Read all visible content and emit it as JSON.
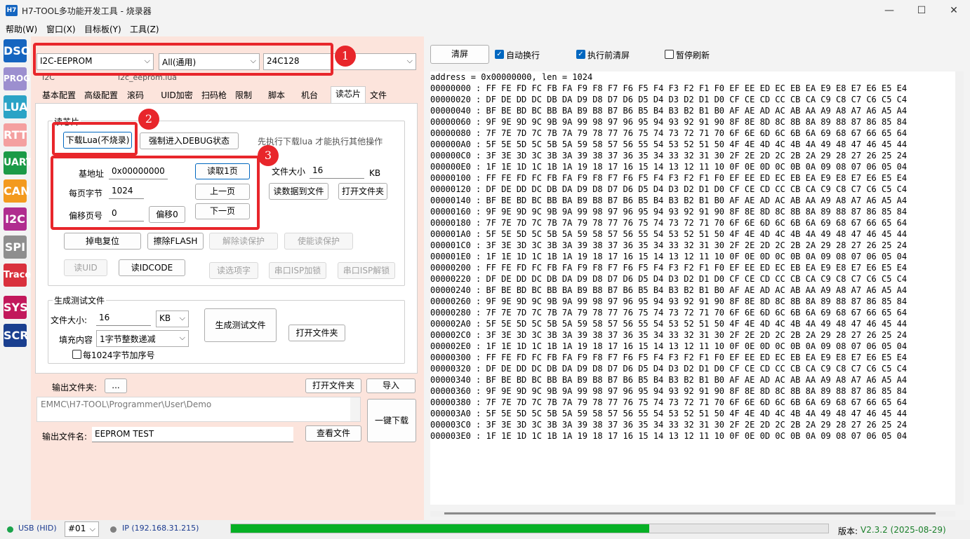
{
  "window": {
    "title": "H7-TOOL多功能开发工具 - 烧录器",
    "icon_text": "H7",
    "controls": {
      "minimize": "—",
      "maximize": "☐",
      "close": "✕"
    }
  },
  "menu": [
    {
      "label": "帮助(W)"
    },
    {
      "label": "窗口(X)"
    },
    {
      "label": "目标板(Y)"
    },
    {
      "label": "工具(Z)"
    }
  ],
  "sidebar": [
    {
      "label": "DSO",
      "color": "#1565c0"
    },
    {
      "label": "PROG",
      "color": "#9c8fcf"
    },
    {
      "label": "LUA",
      "color": "#2aa3c6"
    },
    {
      "label": "RTT",
      "color": "#f4a0a0"
    },
    {
      "label": "UART",
      "color": "#1b9a47"
    },
    {
      "label": "CAN",
      "color": "#f39a1e"
    },
    {
      "label": "I2C",
      "color": "#b02d8f"
    },
    {
      "label": "SPI",
      "color": "#8e8e8e"
    },
    {
      "label": "Trace",
      "color": "#d9313d"
    },
    {
      "label": "SYS",
      "color": "#c2185b"
    },
    {
      "label": "SCR",
      "color": "#1a3f8f"
    }
  ],
  "device": {
    "vendor": "I2C-EEPROM",
    "series": "All(通用)",
    "chip": "24C128",
    "type_hint": "I2C",
    "lua_file": "i2c_eeprom.lua",
    "arrow": "⌵"
  },
  "tabs": [
    {
      "label": "基本配置"
    },
    {
      "label": "高级配置"
    },
    {
      "label": "滚码"
    },
    {
      "label": "UID加密"
    },
    {
      "label": "扫码枪"
    },
    {
      "label": "限制"
    },
    {
      "label": "脚本"
    },
    {
      "label": "机台"
    },
    {
      "label": "读芯片"
    },
    {
      "label": "文件"
    }
  ],
  "read_group": {
    "title": "读芯片",
    "download_lua": "下载Lua(不烧录)",
    "force_debug": "强制进入DEBUG状态",
    "hint": "先执行下载lua 才能执行其他操作",
    "base_addr_label": "基地址",
    "base_addr": "0x00000000",
    "page_bytes_label": "每页字节",
    "page_bytes": "1024",
    "offset_label": "偏移页号",
    "offset": "0",
    "offset0_btn": "偏移0",
    "read_page": "读取1页",
    "prev_page": "上一页",
    "next_page": "下一页",
    "file_size_label": "文件大小",
    "file_size": "16",
    "file_size_unit": "KB",
    "read_to_file": "读数据到文件",
    "open_folder": "打开文件夹",
    "power_reset": "掉电复位",
    "erase_flash": "擦除FLASH",
    "unlock_read": "解除读保护",
    "enable_read": "使能读保护",
    "read_uid": "读UID",
    "read_idcode": "读IDCODE",
    "read_option": "读选项字",
    "serial_isp_lock": "串口ISP加锁",
    "serial_isp_unlock": "串口ISP解锁"
  },
  "gen_group": {
    "title": "生成测试文件",
    "size_label": "文件大小:",
    "size": "16",
    "unit": "KB",
    "fill_label": "填充内容",
    "fill": "1字节整数递减",
    "seq_label": "每1024字节加序号",
    "generate": "生成测试文件",
    "open_folder": "打开文件夹"
  },
  "output": {
    "folder_label": "输出文件夹:",
    "browse": "...",
    "open_folder": "打开文件夹",
    "import": "导入",
    "path": "EMMC\\H7-TOOL\\Programmer\\User\\Demo",
    "name_label": "输出文件名:",
    "name": "EEPROM TEST",
    "view_file": "查看文件",
    "one_click": "一键下载"
  },
  "annotations": [
    "1",
    "2",
    "3"
  ],
  "right_toolbar": {
    "clear": "清屏",
    "auto_wrap": "自动换行",
    "clear_before": "执行前清屏",
    "pause_refresh": "暂停刷新",
    "check_mark": "✓"
  },
  "hex": {
    "header": "address = 0x00000000, len = 1024",
    "lines": [
      "00000000 : FF FE FD FC FB FA F9 F8 F7 F6 F5 F4 F3 F2 F1 F0 EF EE ED EC EB EA E9 E8 E7 E6 E5 E4",
      "00000020 : DF DE DD DC DB DA D9 D8 D7 D6 D5 D4 D3 D2 D1 D0 CF CE CD CC CB CA C9 C8 C7 C6 C5 C4",
      "00000040 : BF BE BD BC BB BA B9 B8 B7 B6 B5 B4 B3 B2 B1 B0 AF AE AD AC AB AA A9 A8 A7 A6 A5 A4",
      "00000060 : 9F 9E 9D 9C 9B 9A 99 98 97 96 95 94 93 92 91 90 8F 8E 8D 8C 8B 8A 89 88 87 86 85 84",
      "00000080 : 7F 7E 7D 7C 7B 7A 79 78 77 76 75 74 73 72 71 70 6F 6E 6D 6C 6B 6A 69 68 67 66 65 64",
      "000000A0 : 5F 5E 5D 5C 5B 5A 59 58 57 56 55 54 53 52 51 50 4F 4E 4D 4C 4B 4A 49 48 47 46 45 44",
      "000000C0 : 3F 3E 3D 3C 3B 3A 39 38 37 36 35 34 33 32 31 30 2F 2E 2D 2C 2B 2A 29 28 27 26 25 24",
      "000000E0 : 1F 1E 1D 1C 1B 1A 19 18 17 16 15 14 13 12 11 10 0F 0E 0D 0C 0B 0A 09 08 07 06 05 04",
      "00000100 : FF FE FD FC FB FA F9 F8 F7 F6 F5 F4 F3 F2 F1 F0 EF EE ED EC EB EA E9 E8 E7 E6 E5 E4",
      "00000120 : DF DE DD DC DB DA D9 D8 D7 D6 D5 D4 D3 D2 D1 D0 CF CE CD CC CB CA C9 C8 C7 C6 C5 C4",
      "00000140 : BF BE BD BC BB BA B9 B8 B7 B6 B5 B4 B3 B2 B1 B0 AF AE AD AC AB AA A9 A8 A7 A6 A5 A4",
      "00000160 : 9F 9E 9D 9C 9B 9A 99 98 97 96 95 94 93 92 91 90 8F 8E 8D 8C 8B 8A 89 88 87 86 85 84",
      "00000180 : 7F 7E 7D 7C 7B 7A 79 78 77 76 75 74 73 72 71 70 6F 6E 6D 6C 6B 6A 69 68 67 66 65 64",
      "000001A0 : 5F 5E 5D 5C 5B 5A 59 58 57 56 55 54 53 52 51 50 4F 4E 4D 4C 4B 4A 49 48 47 46 45 44",
      "000001C0 : 3F 3E 3D 3C 3B 3A 39 38 37 36 35 34 33 32 31 30 2F 2E 2D 2C 2B 2A 29 28 27 26 25 24",
      "000001E0 : 1F 1E 1D 1C 1B 1A 19 18 17 16 15 14 13 12 11 10 0F 0E 0D 0C 0B 0A 09 08 07 06 05 04",
      "00000200 : FF FE FD FC FB FA F9 F8 F7 F6 F5 F4 F3 F2 F1 F0 EF EE ED EC EB EA E9 E8 E7 E6 E5 E4",
      "00000220 : DF DE DD DC DB DA D9 D8 D7 D6 D5 D4 D3 D2 D1 D0 CF CE CD CC CB CA C9 C8 C7 C6 C5 C4",
      "00000240 : BF BE BD BC BB BA B9 B8 B7 B6 B5 B4 B3 B2 B1 B0 AF AE AD AC AB AA A9 A8 A7 A6 A5 A4",
      "00000260 : 9F 9E 9D 9C 9B 9A 99 98 97 96 95 94 93 92 91 90 8F 8E 8D 8C 8B 8A 89 88 87 86 85 84",
      "00000280 : 7F 7E 7D 7C 7B 7A 79 78 77 76 75 74 73 72 71 70 6F 6E 6D 6C 6B 6A 69 68 67 66 65 64",
      "000002A0 : 5F 5E 5D 5C 5B 5A 59 58 57 56 55 54 53 52 51 50 4F 4E 4D 4C 4B 4A 49 48 47 46 45 44",
      "000002C0 : 3F 3E 3D 3C 3B 3A 39 38 37 36 35 34 33 32 31 30 2F 2E 2D 2C 2B 2A 29 28 27 26 25 24",
      "000002E0 : 1F 1E 1D 1C 1B 1A 19 18 17 16 15 14 13 12 11 10 0F 0E 0D 0C 0B 0A 09 08 07 06 05 04",
      "00000300 : FF FE FD FC FB FA F9 F8 F7 F6 F5 F4 F3 F2 F1 F0 EF EE ED EC EB EA E9 E8 E7 E6 E5 E4",
      "00000320 : DF DE DD DC DB DA D9 D8 D7 D6 D5 D4 D3 D2 D1 D0 CF CE CD CC CB CA C9 C8 C7 C6 C5 C4",
      "00000340 : BF BE BD BC BB BA B9 B8 B7 B6 B5 B4 B3 B2 B1 B0 AF AE AD AC AB AA A9 A8 A7 A6 A5 A4",
      "00000360 : 9F 9E 9D 9C 9B 9A 99 98 97 96 95 94 93 92 91 90 8F 8E 8D 8C 8B 8A 89 88 87 86 85 84",
      "00000380 : 7F 7E 7D 7C 7B 7A 79 78 77 76 75 74 73 72 71 70 6F 6E 6D 6C 6B 6A 69 68 67 66 65 64",
      "000003A0 : 5F 5E 5D 5C 5B 5A 59 58 57 56 55 54 53 52 51 50 4F 4E 4D 4C 4B 4A 49 48 47 46 45 44",
      "000003C0 : 3F 3E 3D 3C 3B 3A 39 38 37 36 35 34 33 32 31 30 2F 2E 2D 2C 2B 2A 29 28 27 26 25 24",
      "000003E0 : 1F 1E 1D 1C 1B 1A 19 18 17 16 15 14 13 12 11 10 0F 0E 0D 0C 0B 0A 09 08 07 06 05 04"
    ]
  },
  "status": {
    "usb": "USB (HID)",
    "port": "#01",
    "ip": "IP (192.168.31.215)",
    "progress_fraction": 0.7,
    "version_label": "版本:",
    "version": "V2.3.2 (2025-08-29)"
  },
  "colors": {
    "accent": "#0067c0",
    "annotation": "#e8262b",
    "left_bg": "#fce4dc",
    "progress": "#06b025",
    "usb_dot": "#1aa34a",
    "ip_dot": "#808080",
    "version": "#1a7f2a"
  }
}
